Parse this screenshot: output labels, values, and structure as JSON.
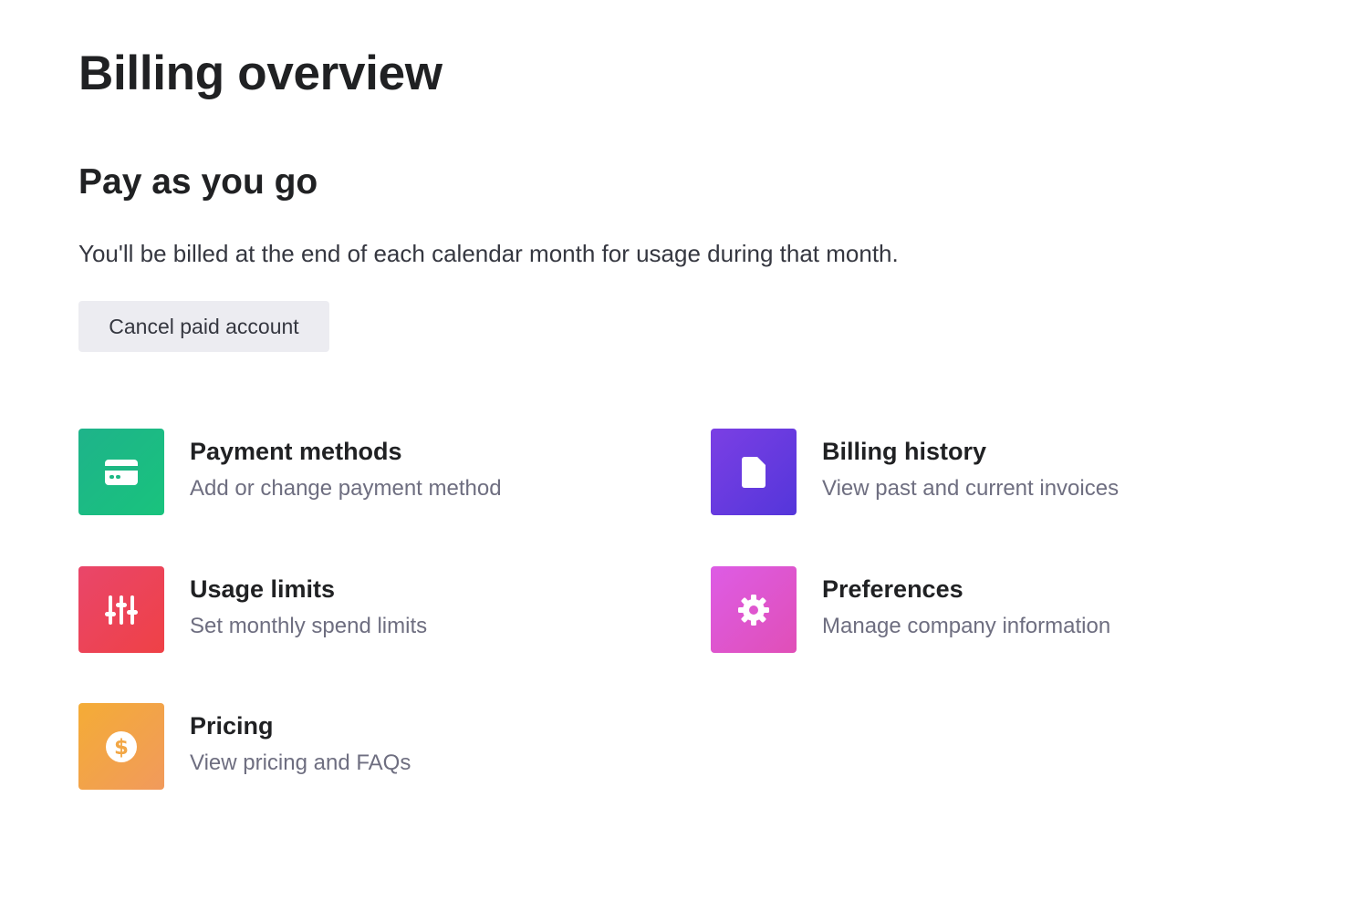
{
  "page": {
    "title": "Billing overview"
  },
  "plan": {
    "title": "Pay as you go",
    "description": "You'll be billed at the end of each calendar month for usage during that month.",
    "cancel_label": "Cancel paid account"
  },
  "cards": {
    "payment_methods": {
      "title": "Payment methods",
      "subtitle": "Add or change payment method",
      "icon": "credit-card-icon",
      "color": "#19c37d"
    },
    "billing_history": {
      "title": "Billing history",
      "subtitle": "View past and current invoices",
      "icon": "document-icon",
      "color": "#5436da"
    },
    "usage_limits": {
      "title": "Usage limits",
      "subtitle": "Set monthly spend limits",
      "icon": "sliders-icon",
      "color": "#ef4146"
    },
    "preferences": {
      "title": "Preferences",
      "subtitle": "Manage company information",
      "icon": "gear-icon",
      "color": "#dd5ce5"
    },
    "pricing": {
      "title": "Pricing",
      "subtitle": "View pricing and FAQs",
      "icon": "dollar-icon",
      "color": "#f4ac36"
    }
  }
}
